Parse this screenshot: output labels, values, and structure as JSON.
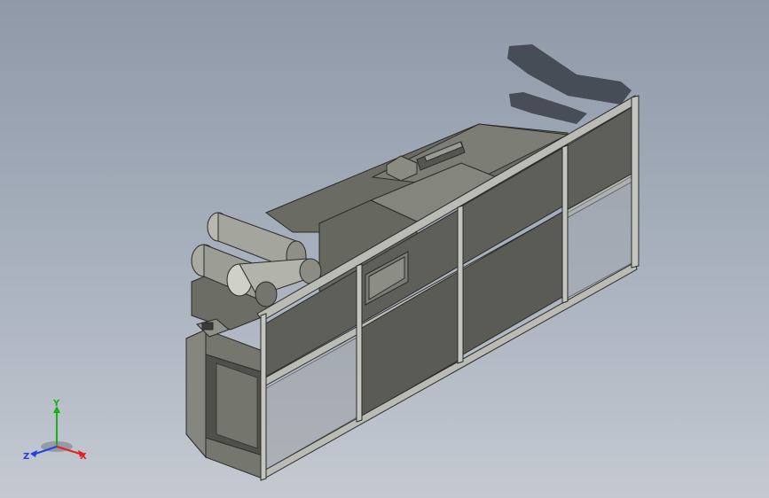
{
  "viewport": {
    "background_top": "#8f99a8",
    "background_bottom": "#c4c9d1"
  },
  "model": {
    "body_color": "#6f7068",
    "panel_color": "#5e5f59",
    "frame_color": "#b9bbb4",
    "edge_color": "#2a2b28"
  },
  "triad": {
    "x_label": "X",
    "y_label": "Y",
    "z_label": "Z",
    "x_color": "#e02020",
    "y_color": "#1ab01a",
    "z_color": "#2040e0"
  }
}
